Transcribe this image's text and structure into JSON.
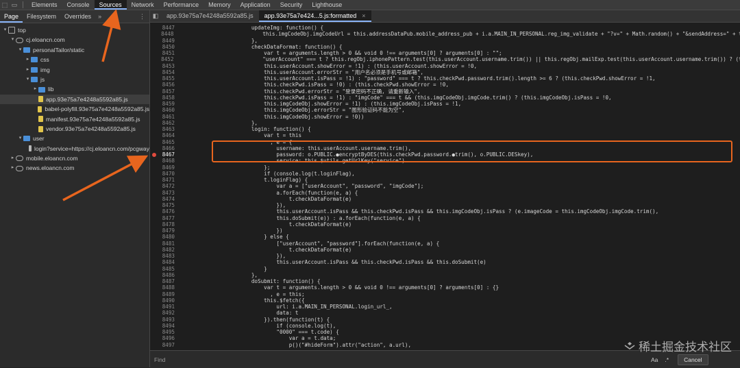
{
  "toolbar": {
    "panel_tabs": [
      "Elements",
      "Console",
      "Sources",
      "Network",
      "Performance",
      "Memory",
      "Application",
      "Security",
      "Lighthouse"
    ],
    "active_tab": "Sources"
  },
  "sidebar": {
    "tabs": [
      "Page",
      "Filesystem",
      "Overrides"
    ],
    "more": "»",
    "menu": "⋮",
    "tree": [
      {
        "label": "top",
        "depth": 0,
        "twisty": "▾",
        "icon": "frame"
      },
      {
        "label": "cj.eloancn.com",
        "depth": 1,
        "twisty": "▾",
        "icon": "cloud"
      },
      {
        "label": "personalTailor/static",
        "depth": 2,
        "twisty": "▾",
        "icon": "folder"
      },
      {
        "label": "css",
        "depth": 3,
        "twisty": "▸",
        "icon": "folder"
      },
      {
        "label": "img",
        "depth": 3,
        "twisty": "▸",
        "icon": "folder"
      },
      {
        "label": "js",
        "depth": 3,
        "twisty": "▾",
        "icon": "folder"
      },
      {
        "label": "lib",
        "depth": 4,
        "twisty": "▸",
        "icon": "folder"
      },
      {
        "label": "app.93e75a7e4248a5592a85.js",
        "depth": 4,
        "twisty": "",
        "icon": "script",
        "selected": true
      },
      {
        "label": "babel-polyfill.93e75a7e4248a5592a85.js",
        "depth": 4,
        "twisty": "",
        "icon": "script"
      },
      {
        "label": "manifest.93e75a7e4248a5592a85.js",
        "depth": 4,
        "twisty": "",
        "icon": "script"
      },
      {
        "label": "vendor.93e75a7e4248a5592a85.js",
        "depth": 4,
        "twisty": "",
        "icon": "script"
      },
      {
        "label": "user",
        "depth": 2,
        "twisty": "▾",
        "icon": "folder"
      },
      {
        "label": "login?service=https://cj.eloancn.com/pcgway",
        "depth": 3,
        "twisty": "",
        "icon": "doc"
      },
      {
        "label": "mobile.eloancn.com",
        "depth": 1,
        "twisty": "▸",
        "icon": "cloud"
      },
      {
        "label": "news.eloancn.com",
        "depth": 1,
        "twisty": "▸",
        "icon": "cloud"
      }
    ]
  },
  "editor": {
    "tabs": [
      {
        "label": "app.93e75a7e4248a5592a85.js",
        "active": false
      },
      {
        "label": "app.93e75a7e424...5.js:formatted",
        "active": true
      }
    ],
    "close_glyph": "×",
    "lines": [
      {
        "n": "8447",
        "code": "            updateImg: function() {"
      },
      {
        "n": "8448",
        "code": "                this.imgCodeObj.imgCodeUrl = this.addressDataPub.mobile_address_pub + i.a.MAIN_IN_PERSONAL.reg_img_validate + \"?v=\" + Math.random() + \"&sendAddress=\" + this.use"
      },
      {
        "n": "8449",
        "code": "            },"
      },
      {
        "n": "8450",
        "code": "            checkDataFormat: function() {"
      },
      {
        "n": "8451",
        "code": "                var t = arguments.length > 0 && void 0 !== arguments[0] ? arguments[0] : \"\";"
      },
      {
        "n": "8452",
        "code": "                \"userAccount\" === t ? this.regObj.iphonePattern.test(this.userAccount.username.trim()) || this.regObj.mailExp.test(this.userAccount.username.trim()) ? (this.use"
      },
      {
        "n": "8453",
        "code": "                this.userAccount.showError = !1) : (this.userAccount.showError = !0,"
      },
      {
        "n": "8454",
        "code": "                this.userAccount.errorStr = \"用户名必须是手机号或邮箱\","
      },
      {
        "n": "8455",
        "code": "                this.userAccount.isPass = !1) : \"password\" === t ? this.checkPwd.password.trim().length >= 6 ? (this.checkPwd.showError = !1,"
      },
      {
        "n": "8456",
        "code": "                this.checkPwd.isPass = !0) : (this.checkPwd.showError = !0,"
      },
      {
        "n": "8457",
        "code": "                this.checkPwd.errorStr = \"登录密码不正确, 请重新输入\","
      },
      {
        "n": "8458",
        "code": "                this.checkPwd.isPass = !1) : \"imgCode\" === t && (this.imgCodeObj.imgCode.trim() ? (this.imgCodeObj.isPass = !0,"
      },
      {
        "n": "8459",
        "code": "                this.imgCodeObj.showError = !1) : (this.imgCodeObj.isPass = !1,"
      },
      {
        "n": "8460",
        "code": "                this.imgCodeObj.errorStr = \"图形验证码不能为空\","
      },
      {
        "n": "8461",
        "code": "                this.imgCodeObj.showError = !0))"
      },
      {
        "n": "8462",
        "code": "            },"
      },
      {
        "n": "8463",
        "code": "            login: function() {"
      },
      {
        "n": "8464",
        "code": "                var t = this"
      },
      {
        "n": "8465",
        "code": "                  , e = {"
      },
      {
        "n": "8466",
        "code": "                    username: this.userAccount.username.trim(),"
      },
      {
        "n": "8467",
        "code": "                    password: o.PUBLIC.●encryptByDES(this.checkPwd.password.●trim(), o.PUBLIC.DESkey),",
        "breakpoint": true
      },
      {
        "n": "8468",
        "code": "                    service: this.$utils.getUrlKey(\"service\")"
      },
      {
        "n": "8469",
        "code": "                };"
      },
      {
        "n": "8470",
        "code": "                if (console.log(t.loginFlag),"
      },
      {
        "n": "8471",
        "code": "                t.loginFlag) {"
      },
      {
        "n": "8472",
        "code": "                    var a = [\"userAccount\", \"password\", \"imgCode\"];"
      },
      {
        "n": "8473",
        "code": "                    a.forEach(function(e, a) {"
      },
      {
        "n": "8474",
        "code": "                        t.checkDataFormat(e)"
      },
      {
        "n": "8475",
        "code": "                    }),"
      },
      {
        "n": "8476",
        "code": "                    this.userAccount.isPass && this.checkPwd.isPass && this.imgCodeObj.isPass ? (e.imageCode = this.imgCodeObj.imgCode.trim(),"
      },
      {
        "n": "8477",
        "code": "                    this.doSubmit(e)) : a.forEach(function(e, a) {"
      },
      {
        "n": "8478",
        "code": "                        t.checkDataFormat(e)"
      },
      {
        "n": "8479",
        "code": "                    })"
      },
      {
        "n": "8480",
        "code": "                } else {"
      },
      {
        "n": "8481",
        "code": "                    [\"userAccount\", \"password\"].forEach(function(e, a) {"
      },
      {
        "n": "8482",
        "code": "                        t.checkDataFormat(e)"
      },
      {
        "n": "8483",
        "code": "                    }),"
      },
      {
        "n": "8484",
        "code": "                    this.userAccount.isPass && this.checkPwd.isPass && this.doSubmit(e)"
      },
      {
        "n": "8485",
        "code": "                }"
      },
      {
        "n": "8486",
        "code": "            },"
      },
      {
        "n": "8487",
        "code": "            doSubmit: function() {"
      },
      {
        "n": "8488",
        "code": "                var t = arguments.length > 0 && void 0 !== arguments[0] ? arguments[0] : {}"
      },
      {
        "n": "8489",
        "code": "                  , e = this;"
      },
      {
        "n": "8490",
        "code": "                this.$fetch({"
      },
      {
        "n": "8491",
        "code": "                    url: i.a.MAIN_IN_PERSONAL.login_url_,"
      },
      {
        "n": "8492",
        "code": "                    data: t"
      },
      {
        "n": "8493",
        "code": "                }).then(function(t) {"
      },
      {
        "n": "8494",
        "code": "                    if (console.log(t),"
      },
      {
        "n": "8495",
        "code": "                    \"0000\" === t.code) {"
      },
      {
        "n": "8496",
        "code": "                        var a = t.data;"
      },
      {
        "n": "8497",
        "code": "                        p()(\"#hideForm\").attr(\"action\", a.url),"
      }
    ]
  },
  "findbar": {
    "placeholder": "Find",
    "aa": "Aa",
    "regex": ".*",
    "cancel": "Cancel"
  },
  "watermark": "稀土掘金技术社区",
  "colors": {
    "highlight_box": "#e8651e",
    "arrow": "#e8651e",
    "breakpoint": "#e14b3e",
    "accent": "#8ab4f8"
  }
}
